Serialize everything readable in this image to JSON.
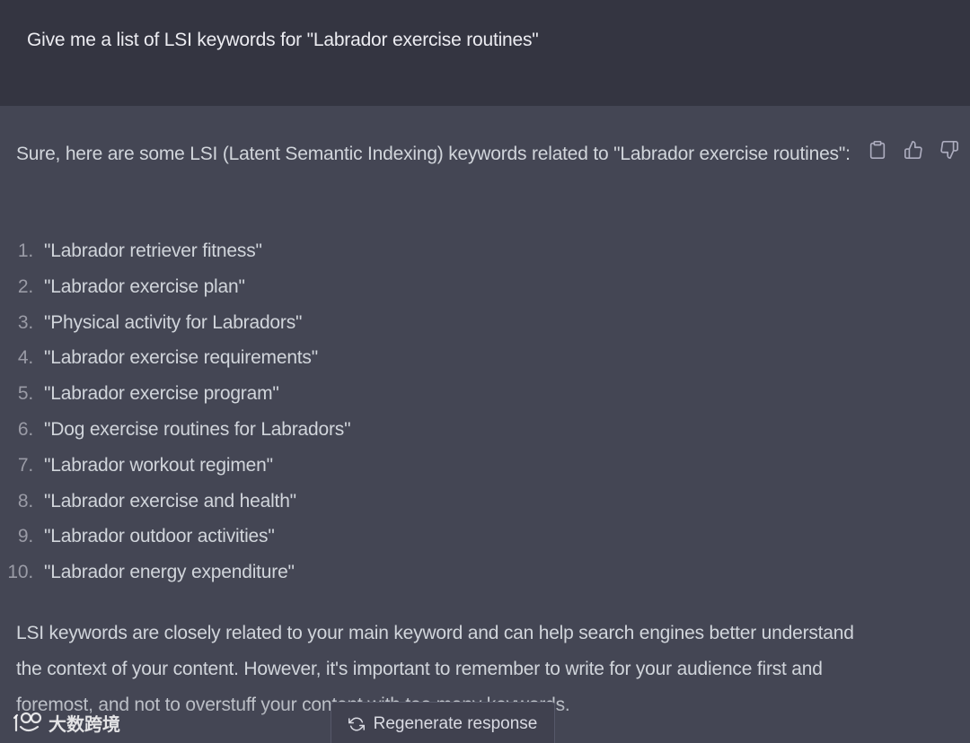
{
  "user_message": {
    "text": "Give me a list of LSI keywords for \"Labrador exercise routines\""
  },
  "assistant_message": {
    "intro": "Sure, here are some LSI (Latent Semantic Indexing) keywords related to \"Labrador exercise routines\":",
    "keywords": [
      {
        "num": "1.",
        "text": "\"Labrador retriever fitness\""
      },
      {
        "num": "2.",
        "text": "\"Labrador exercise plan\""
      },
      {
        "num": "3.",
        "text": "\"Physical activity for Labradors\""
      },
      {
        "num": "4.",
        "text": "\"Labrador exercise requirements\""
      },
      {
        "num": "5.",
        "text": "\"Labrador exercise program\""
      },
      {
        "num": "6.",
        "text": "\"Dog exercise routines for Labradors\""
      },
      {
        "num": "7.",
        "text": "\"Labrador workout regimen\""
      },
      {
        "num": "8.",
        "text": "\"Labrador exercise and health\""
      },
      {
        "num": "9.",
        "text": "\"Labrador outdoor activities\""
      },
      {
        "num": "10.",
        "text": "\"Labrador energy expenditure\""
      }
    ],
    "outro": "LSI keywords are closely related to your main keyword and can help search engines better understand the context of your content. However, it's important to remember to write for your audience first and foremost, and not to overstuff your content with too many keywords.",
    "actions": {
      "copy_icon": "clipboard-icon",
      "like_icon": "thumbs-up-icon",
      "dislike_icon": "thumbs-down-icon"
    }
  },
  "regenerate_button": {
    "label": "Regenerate response",
    "icon": "refresh-icon"
  },
  "watermark": {
    "text": "大数跨境"
  },
  "colors": {
    "user_bg": "#343541",
    "assistant_bg": "#444654",
    "text": "#d1d5db",
    "button_bg": "#40414f"
  }
}
